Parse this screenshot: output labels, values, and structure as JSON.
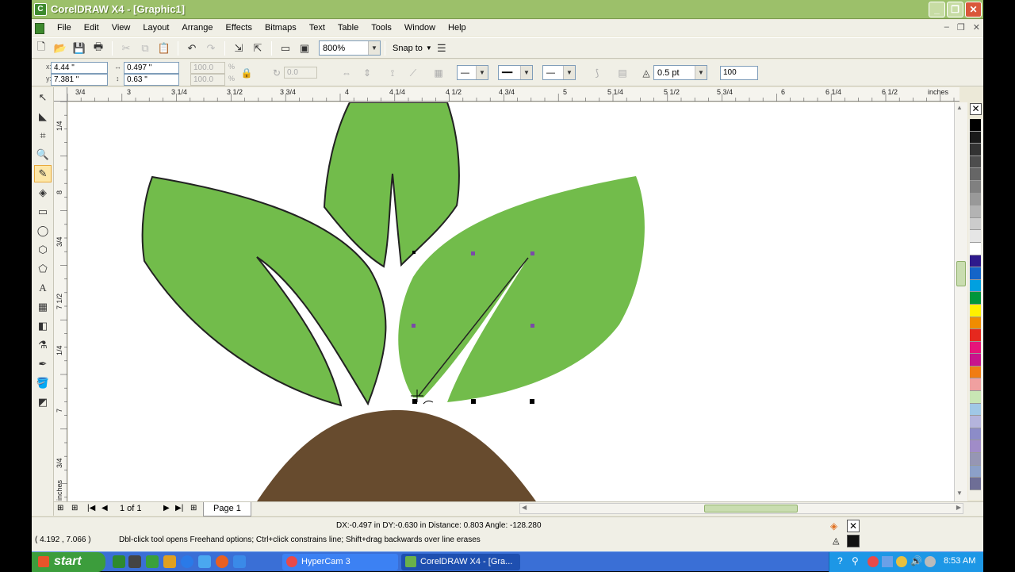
{
  "window": {
    "title": "CorelDRAW X4 - [Graphic1]",
    "app_icon": "coreldraw-icon"
  },
  "menu": [
    "File",
    "Edit",
    "View",
    "Layout",
    "Arrange",
    "Effects",
    "Bitmaps",
    "Text",
    "Table",
    "Tools",
    "Window",
    "Help"
  ],
  "toolbar": {
    "zoom": "800%",
    "snap_to": "Snap to"
  },
  "properties": {
    "x": "4.44 \"",
    "y": "7.381 \"",
    "width": "0.497 \"",
    "height": "0.63 \"",
    "scale_w": "100.0",
    "scale_h": "100.0",
    "pct": "%",
    "angle": "0.0",
    "outline_width": "0.5 pt",
    "smoothing": "100"
  },
  "ruler": {
    "h_labels": [
      "3/4",
      "3",
      "3 1/4",
      "3 1/2",
      "3 3/4",
      "4",
      "4 1/4",
      "4 1/2",
      "4 3/4",
      "5",
      "5 1/4",
      "5 1/2",
      "5 3/4",
      "6",
      "6 1/4",
      "6 1/2"
    ],
    "unit": "inches",
    "v_labels": [
      "1/4",
      "8",
      "3/4",
      "7 1/2",
      "1/4",
      "7",
      "3/4",
      "inches"
    ]
  },
  "page_nav": {
    "count": "1 of 1",
    "tab": "Page 1"
  },
  "status": {
    "measure": "DX:-0.497 in DY:-0.630 in Distance: 0.803 Angle: -128.280",
    "coords": "( 4.192 , 7.066 )",
    "hint": "Dbl-click tool opens Freehand options; Ctrl+click constrains line; Shift+drag backwards over line erases"
  },
  "taskbar": {
    "start": "start",
    "tasks": [
      "HyperCam 3",
      "CorelDRAW X4 - [Gra..."
    ],
    "clock": "8:53 AM"
  },
  "palette": [
    "#000000",
    "#1a1a1a",
    "#333333",
    "#4d4d4d",
    "#666666",
    "#808080",
    "#999999",
    "#b3b3b3",
    "#cccccc",
    "#e6e6e6",
    "#ffffff",
    "#2e1a8c",
    "#1464c8",
    "#00a0e0",
    "#00963c",
    "#fff000",
    "#f08c00",
    "#e6281e",
    "#e6147a",
    "#c8148c",
    "#f07c14",
    "#f0a0a0",
    "#c8e6b4",
    "#a0c8e6",
    "#b4b4dc",
    "#8c8cc8",
    "#a08cc8",
    "#9696b4",
    "#8ca0c8",
    "#6e6e96"
  ],
  "colors": {
    "leaf": "#72bc4b",
    "soil": "#674b2e",
    "outline": "#222222"
  }
}
